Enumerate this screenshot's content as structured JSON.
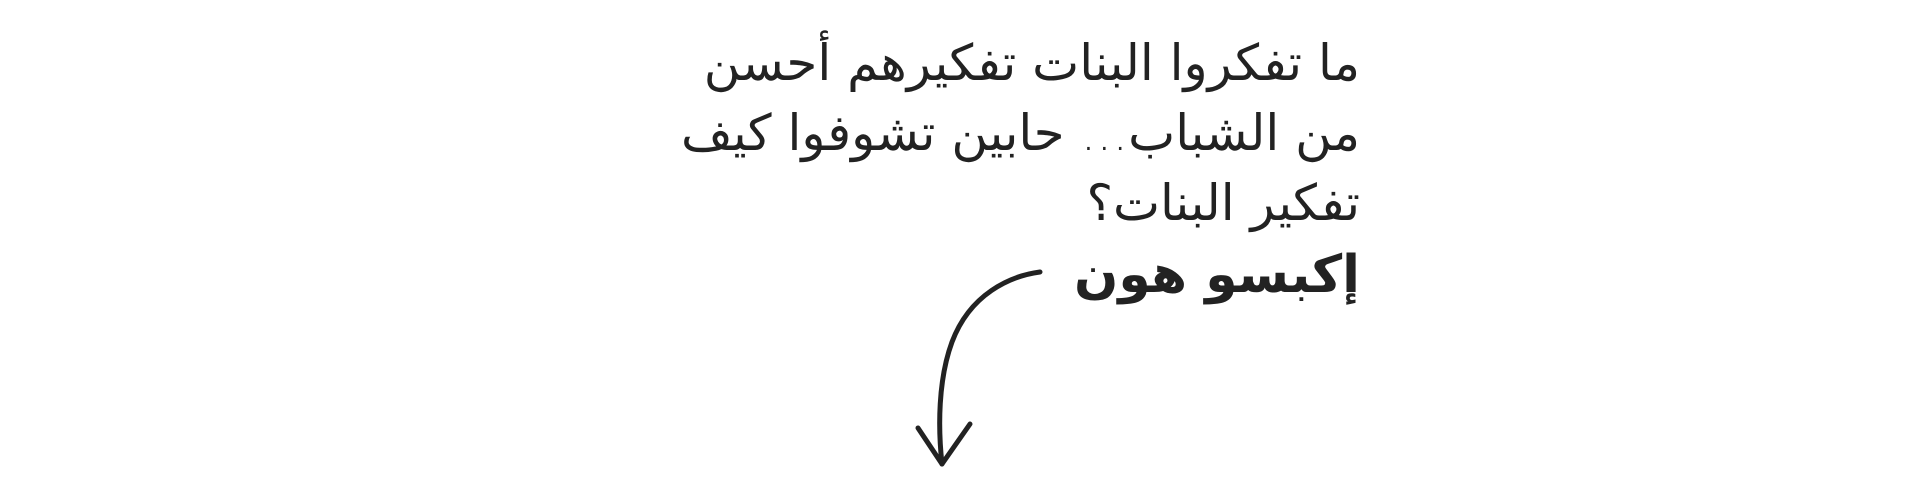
{
  "content": {
    "lines": [
      "ما تفكروا البنات تفكيرهم أحسن",
      "من الشباب... حابين تشوفوا كيف",
      "تفكير البنات؟"
    ],
    "cta_label": "إكبسو هون"
  },
  "colors": {
    "text": "#222222",
    "background": "#ffffff"
  },
  "icons": {
    "arrow": "hand-drawn-curved-arrow-down-icon"
  }
}
